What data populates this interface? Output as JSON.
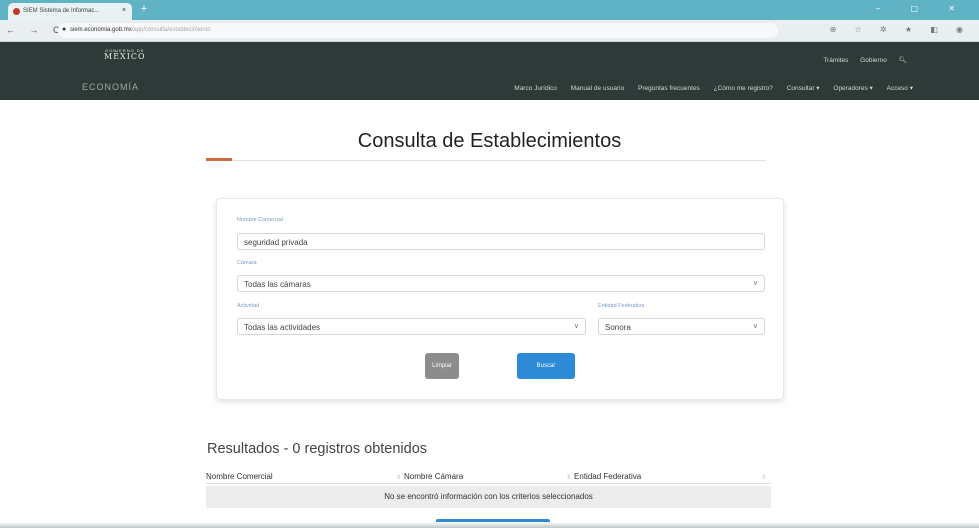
{
  "browser": {
    "tab_title": "SIEM Sistema de Informac...",
    "tab_close": "×",
    "new_tab": "+",
    "window_controls": "–  ▢  ✕",
    "nav_buttons": "← → C",
    "url_host": "siem.economia.gob.mx",
    "url_rest": "/app/consulta/establecimiento",
    "ext_icons": "⊕ ☆ ✲ ★ ◧ ◉"
  },
  "gob_header": {
    "logo_small": "GOBIERNO DE",
    "logo_big": "MÉXICO",
    "top_links": [
      "Trámites",
      "Gobierno"
    ],
    "search_icon": "search-icon",
    "site_name": "ECONOMÍA",
    "main_nav": [
      "Marco Jurídico",
      "Manual de usuario",
      "Preguntas frecuentes",
      "¿Cómo me registro?",
      "Consultar ▾",
      "Operadores ▾",
      "Acceso ▾"
    ]
  },
  "page": {
    "title": "Consulta de Establecimientos"
  },
  "form": {
    "nombre_label": "Nombre Comercial",
    "nombre_value": "seguridad privada",
    "camara_label": "Cámara",
    "camara_value": "Todas las cámaras",
    "actividad_label": "Actividad",
    "actividad_value": "Todas las actividades",
    "entidad_label": "Entidad Federativa",
    "entidad_value": "Sonora",
    "chevron": "∨",
    "clear_label": "Limpiar",
    "search_label": "Buscar"
  },
  "results": {
    "title": "Resultados - 0 registros obtenidos",
    "columns": [
      "Nombre Comercial",
      "Nombre Cámara",
      "Entidad Federativa"
    ],
    "sort_glyph": "⇕",
    "empty_message": "No se encontró información con los criterios seleccionados"
  },
  "colors": {
    "header_bg": "#2d3a38",
    "primary_button": "#2c8ad7",
    "clear_button": "#8c8c8c",
    "accent": "#d06b3f"
  }
}
